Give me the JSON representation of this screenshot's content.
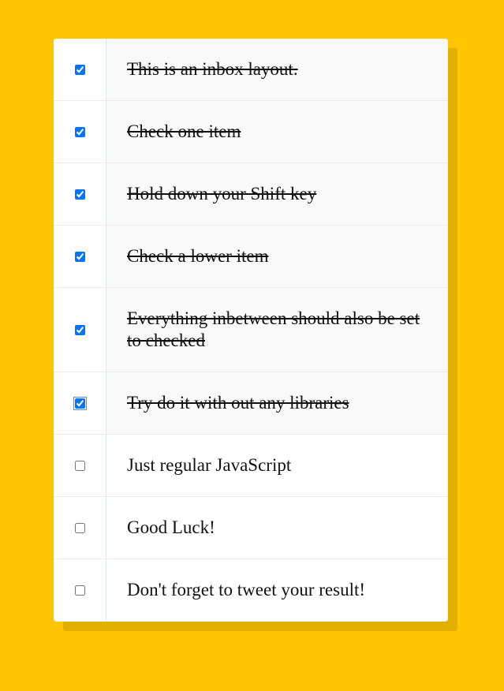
{
  "inbox": {
    "items": [
      {
        "label": "This is an inbox layout.",
        "checked": true
      },
      {
        "label": "Check one item",
        "checked": true
      },
      {
        "label": "Hold down your Shift key",
        "checked": true
      },
      {
        "label": "Check a lower item",
        "checked": true
      },
      {
        "label": "Everything inbetween should also be set to checked",
        "checked": true
      },
      {
        "label": "Try do it with out any libraries",
        "checked": true,
        "focused": true
      },
      {
        "label": "Just regular JavaScript",
        "checked": false
      },
      {
        "label": "Good Luck!",
        "checked": false
      },
      {
        "label": "Don't forget to tweet your result!",
        "checked": false
      }
    ]
  }
}
